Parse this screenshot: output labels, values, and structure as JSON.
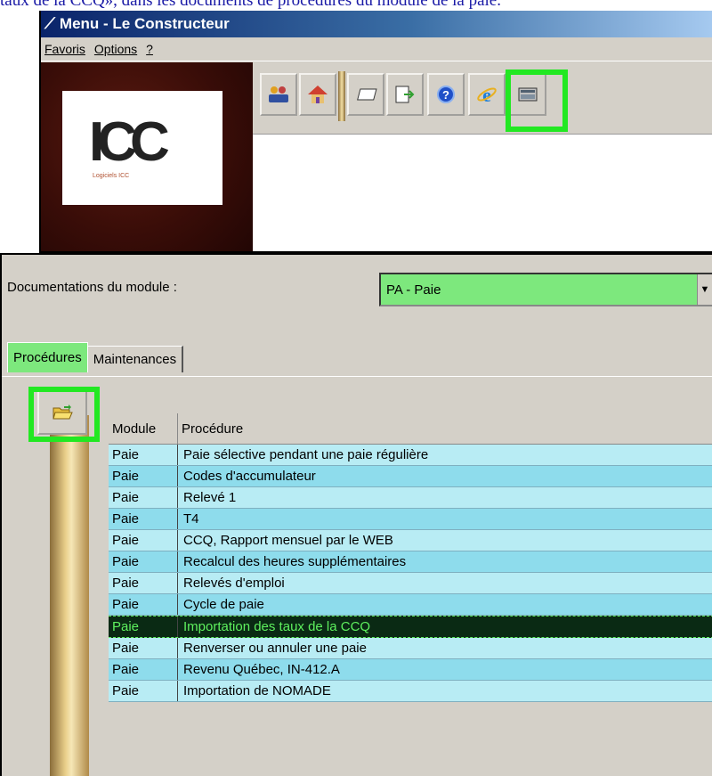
{
  "doc_text": "taux de la CCQ», dans les documents de procédures du module de la paie.",
  "window1": {
    "title": "Menu - Le Constructeur",
    "menu": {
      "favoris": "Favoris",
      "options": "Options",
      "help": "?"
    },
    "logo": {
      "text": "ICC",
      "tagline": "Logiciels ICC"
    },
    "toolbar_icons": [
      "users-icon",
      "home-icon",
      "window-icon",
      "export-icon",
      "help-icon",
      "internet-explorer-icon",
      "calculator-icon"
    ]
  },
  "window2": {
    "module_label": "Documentations du module :",
    "module_value": "PA - Paie",
    "tabs": [
      "Procédures",
      "Maintenances"
    ],
    "columns": [
      "Module",
      "Procédure"
    ],
    "rows": [
      {
        "module": "Paie",
        "procedure": "Paie sélective pendant une paie régulière"
      },
      {
        "module": "Paie",
        "procedure": "Codes d'accumulateur"
      },
      {
        "module": "Paie",
        "procedure": "Relevé 1"
      },
      {
        "module": "Paie",
        "procedure": "T4"
      },
      {
        "module": "Paie",
        "procedure": "CCQ, Rapport mensuel par le WEB"
      },
      {
        "module": "Paie",
        "procedure": "Recalcul des heures supplémentaires"
      },
      {
        "module": "Paie",
        "procedure": "Relevés d'emploi"
      },
      {
        "module": "Paie",
        "procedure": "Cycle de paie"
      },
      {
        "module": "Paie",
        "procedure": "Importation des taux de la CCQ"
      },
      {
        "module": "Paie",
        "procedure": "Renverser ou annuler une paie"
      },
      {
        "module": "Paie",
        "procedure": "Revenu Québec, IN-412.A"
      },
      {
        "module": "Paie",
        "procedure": "Importation de NOMADE"
      }
    ],
    "selected_row": 8
  },
  "colors": {
    "highlight": "#22e822",
    "select_bg": "#7de87d",
    "row_even": "#b8ecf4",
    "row_odd": "#8edcec",
    "row_selected": "#0a2a14"
  }
}
